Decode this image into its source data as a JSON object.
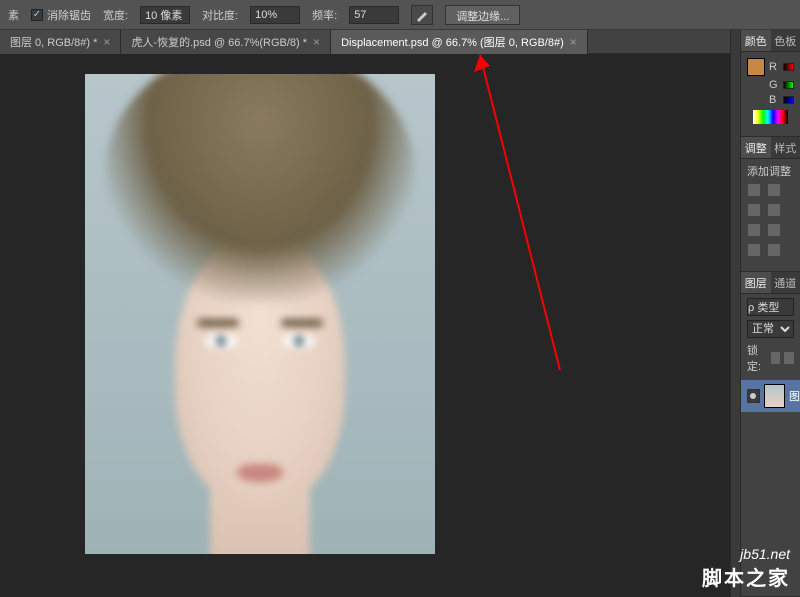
{
  "options": {
    "unit_suffix": "素",
    "antialias_label": "消除锯齿",
    "antialias_checked": true,
    "width_label": "宽度:",
    "width_value": "10 像素",
    "contrast_label": "对比度:",
    "contrast_value": "10%",
    "frequency_label": "频率:",
    "frequency_value": "57",
    "refine_label": "调整边缘..."
  },
  "tabs": [
    {
      "label": "图层 0, RGB/8#) *",
      "active": false
    },
    {
      "label": "虎人-恢复的.psd @ 66.7%(RGB/8) *",
      "active": false
    },
    {
      "label": "Displacement.psd @ 66.7% (图层 0, RGB/8#)",
      "active": true
    }
  ],
  "panels": {
    "color_tab": "颜色",
    "swatches_tab": "色板",
    "rgb": {
      "r": "R",
      "g": "G",
      "b": "B"
    },
    "adjustments_tab": "调整",
    "styles_tab": "样式",
    "add_adjustment": "添加调整",
    "layers_tab": "图层",
    "channels_tab": "通道",
    "kind_label": "ρ 类型",
    "blend_mode": "正常",
    "lock_label": "锁定:",
    "layer0_name": "图"
  },
  "watermark": {
    "url": "jb51.net",
    "text": "脚本之家"
  }
}
